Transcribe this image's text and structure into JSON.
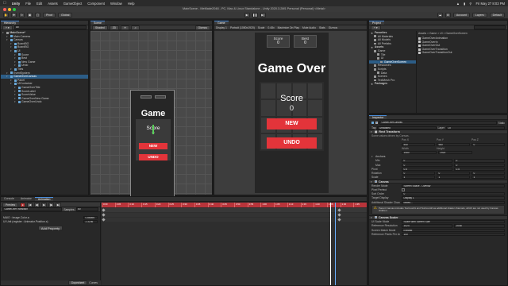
{
  "menubar": {
    "app": "Unity",
    "items": [
      "File",
      "Edit",
      "Assets",
      "GameObject",
      "Component",
      "Window",
      "Help"
    ],
    "clock": "Fri May 27  8:03 PM"
  },
  "window": {
    "title": "MainScene - MeMade2048 - PC, Mac & Linux Standalone - Unity 2020.3.28f1 Personal (Personal) <Metal>"
  },
  "toolbar": {
    "pivot": "Pivot",
    "global": "Global",
    "account": "Account",
    "layers": "Layers",
    "layout": "Default"
  },
  "hierarchy": {
    "tab": "Hierarchy",
    "search": "All",
    "items": [
      {
        "label": "MainScene*",
        "d": 0,
        "type": "scene"
      },
      {
        "label": "Main Camera",
        "d": 1,
        "type": "go"
      },
      {
        "label": "Canvas",
        "d": 1,
        "type": "go"
      },
      {
        "label": "BoardBG",
        "d": 2,
        "type": "go"
      },
      {
        "label": "BoardBG",
        "d": 2,
        "type": "go"
      },
      {
        "label": "UI",
        "d": 2,
        "type": "go"
      },
      {
        "label": "Score",
        "d": 3,
        "type": "go"
      },
      {
        "label": "Best",
        "d": 3,
        "type": "go"
      },
      {
        "label": "New Game",
        "d": 3,
        "type": "go"
      },
      {
        "label": "Undo",
        "d": 3,
        "type": "go"
      },
      {
        "label": "Tiles",
        "d": 2,
        "type": "go"
      },
      {
        "label": "EventSystem",
        "d": 1,
        "type": "go"
      },
      {
        "label": "GameOverCanvas",
        "d": 1,
        "type": "go",
        "sel": true
      },
      {
        "label": "Panel",
        "d": 2,
        "type": "go"
      },
      {
        "label": "UIContainer",
        "d": 2,
        "type": "go"
      },
      {
        "label": "GameOverTitle",
        "d": 3,
        "type": "go"
      },
      {
        "label": "ScoreLabel",
        "d": 3,
        "type": "go"
      },
      {
        "label": "ScoreValue",
        "d": 3,
        "type": "go"
      },
      {
        "label": "GameOverNew Game",
        "d": 3,
        "type": "go"
      },
      {
        "label": "GameOverUndo",
        "d": 3,
        "type": "go"
      }
    ]
  },
  "scene": {
    "tab": "Scene",
    "shading": "Shaded",
    "mode": "2D",
    "gizmos": "Gizmos",
    "search": "All"
  },
  "game": {
    "tab": "Game",
    "display": "Display 1",
    "resolution": "Portrait (1080x1920)",
    "scale_label": "Scale",
    "scale_value": "0.48x",
    "maximize": "Maximize On Play",
    "mute": "Mute Audio",
    "stats": "Stats",
    "gizmos": "Gizmos",
    "hud": {
      "score_label": "Score",
      "score_value": "0",
      "best_label": "Best",
      "best_value": "0"
    },
    "gameover": "Game Over",
    "score_label": "Score",
    "score_value": "0",
    "new_btn": "NEW",
    "undo_btn": "UNDO"
  },
  "project": {
    "tab": "Project",
    "breadcrumb": "Assets > Game > UI > GameOverScreen",
    "tree": [
      {
        "label": "Favorites",
        "d": 0,
        "bold": true
      },
      {
        "label": "All Materials",
        "d": 1
      },
      {
        "label": "All Models",
        "d": 1
      },
      {
        "label": "All Prefabs",
        "d": 1
      },
      {
        "label": "Assets",
        "d": 0,
        "bold": true
      },
      {
        "label": "Game",
        "d": 1
      },
      {
        "label": "Tile",
        "d": 2
      },
      {
        "label": "UI",
        "d": 2
      },
      {
        "label": "GameOverScreen",
        "d": 3,
        "sel": true
      },
      {
        "label": "Resources",
        "d": 1
      },
      {
        "label": "Scripts",
        "d": 1
      },
      {
        "label": "Data",
        "d": 2
      },
      {
        "label": "Scenes",
        "d": 1
      },
      {
        "label": "TextMesh Pro",
        "d": 1
      },
      {
        "label": "Packages",
        "d": 0,
        "bold": true
      }
    ],
    "files": [
      "GameOverAnimation",
      "GameOverIn",
      "GameOverOut",
      "GameOverTransition",
      "GameOverTransitionOut"
    ]
  },
  "inspector": {
    "tab": "Inspector",
    "object_name": "GameOverCanvas",
    "static": "Static",
    "tag_label": "Tag",
    "tag": "Untagged",
    "layer_label": "Layer",
    "layer": "UI",
    "rect": {
      "title": "Rect Transform",
      "note": "Some values driven by Canvas.",
      "pos_labels": [
        "Pos X",
        "Pos Y",
        "Pos Z"
      ],
      "pos": [
        "540",
        "960",
        "0"
      ],
      "size_labels": [
        "Width",
        "Height"
      ],
      "size": [
        "1080",
        "1920"
      ],
      "anchors": "Anchors",
      "min": "Min",
      "max": "Max",
      "pivot": "Pivot",
      "rotation": "Rotation",
      "scale": "Scale",
      "min_v": [
        "0",
        "0"
      ],
      "max_v": [
        "0",
        "0"
      ],
      "pivot_v": [
        "0.5",
        "0.5"
      ],
      "rot_v": [
        "0",
        "0",
        "0"
      ],
      "scale_v": [
        "1",
        "1",
        "1"
      ]
    },
    "canvas": {
      "title": "Canvas",
      "render_mode_label": "Render Mode",
      "render_mode": "Screen Space - Overlay",
      "pixel_perfect": "Pixel Perfect",
      "sort_order": "Sort Order",
      "sort_val": "0",
      "target": "Target Display",
      "target_val": "Display 1",
      "shader": "Additional Shader Channels",
      "shader_val": "Mixed...",
      "warning": "Parent Canvas includes TexCoord1 and TexCoord2 as additional shader channels, which are not used by Canvas children."
    },
    "scaler": {
      "title": "Canvas Scaler",
      "ui_scale_label": "UI Scale Mode",
      "ui_scale": "Scale With Screen Size",
      "ref_label": "Reference Resolution",
      "ref_x": "1024",
      "ref_y": "2048",
      "match_label": "Screen Match Mode",
      "match": "Expand",
      "ppu_label": "Reference Pixels Per Unit",
      "ppu": "100"
    }
  },
  "animation": {
    "tabs": [
      "Console",
      "Animator",
      "Animation"
    ],
    "preview": "Preview",
    "clip": "GameOverTransition",
    "samples_label": "Samples",
    "samples": "60",
    "tracks": [
      {
        "label": "MAIO : Image.Color.a",
        "value": "0.86895"
      },
      {
        "label": "UI Unit (register : Animator.Position.x)",
        "value": "2.3236"
      }
    ],
    "add_property": "Add Property",
    "dopesheet": "Dopesheet",
    "curves": "Curves",
    "ruler": [
      "0:00",
      "0:05",
      "0:10",
      "0:15",
      "0:20",
      "0:25",
      "0:30",
      "0:35",
      "0:40",
      "0:45",
      "0:50",
      "0:55",
      "1:00",
      "1:05",
      "1:10",
      "1:15",
      "1:20",
      "1:25",
      "1:30",
      "1:35"
    ]
  },
  "colors": {
    "accent": "#e3343a",
    "selection": "#2c5d87",
    "canvas_bg": "#262626"
  }
}
